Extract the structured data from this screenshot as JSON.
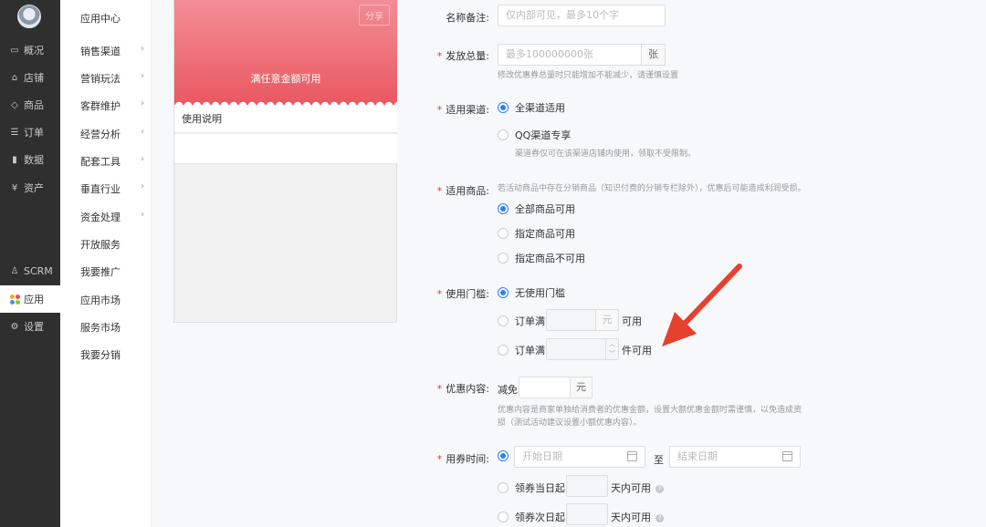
{
  "nav": {
    "items": [
      {
        "icon": "monitor-icon",
        "label": "概况"
      },
      {
        "icon": "store-icon",
        "label": "店铺"
      },
      {
        "icon": "tag-icon",
        "label": "商品"
      },
      {
        "icon": "order-icon",
        "label": "订单"
      },
      {
        "icon": "chart-icon",
        "label": "数据"
      },
      {
        "icon": "yen-icon",
        "label": "资产"
      },
      {
        "icon": "person-icon",
        "label": "SCRM"
      },
      {
        "icon": "apps-icon",
        "label": "应用"
      },
      {
        "icon": "gear-icon",
        "label": "设置"
      }
    ],
    "app_colors": [
      "#f5a623",
      "#e94e4e",
      "#4a90e2",
      "#7ed321"
    ]
  },
  "subnav": {
    "title": "应用中心",
    "items": [
      {
        "label": "销售渠道",
        "chevron": "›"
      },
      {
        "label": "营销玩法",
        "chevron": "›"
      },
      {
        "label": "客群维护",
        "chevron": "›"
      },
      {
        "label": "经营分析",
        "chevron": "›"
      },
      {
        "label": "配套工具",
        "chevron": "›"
      },
      {
        "label": "垂直行业",
        "chevron": "›"
      },
      {
        "label": "资金处理",
        "chevron": "›"
      },
      {
        "label": "开放服务",
        "chevron": ""
      },
      {
        "label": "我要推广",
        "chevron": ""
      },
      {
        "label": "应用市场",
        "chevron": ""
      },
      {
        "label": "服务市场",
        "chevron": ""
      },
      {
        "label": "我要分销",
        "chevron": ""
      }
    ]
  },
  "preview": {
    "share": "分享",
    "banner_text": "满任意金额可用",
    "usage_title": "使用说明"
  },
  "form": {
    "star": "*",
    "name_note": {
      "label": "名称备注:",
      "placeholder": "仅内部可见，最多10个字"
    },
    "total": {
      "label": "发放总量:",
      "placeholder": "最多100000000张",
      "unit": "张",
      "help": "修改优惠券总量时只能增加不能减少，请谨慎设置"
    },
    "channel": {
      "label": "适用渠道:",
      "opt_all": "全渠道适用",
      "opt_qq": "QQ渠道专享",
      "help": "渠道券仅可在该渠道店铺内使用，领取不受限制。"
    },
    "goods": {
      "label": "适用商品:",
      "help": "若活动商品中存在分销商品（知识付费的分销专栏除外），优惠后可能造成利润受损。",
      "opt_all": "全部商品可用",
      "opt_some": "指定商品可用",
      "opt_not": "指定商品不可用"
    },
    "threshold": {
      "label": "使用门槛:",
      "opt_none": "无使用门槛",
      "opt_amount_prefix": "订单满",
      "opt_amount_unit": "元",
      "opt_amount_suffix": "可用",
      "opt_count_prefix": "订单满",
      "opt_count_suffix": "件可用",
      "spin_up": "︿",
      "spin_down": "﹀"
    },
    "discount": {
      "label": "优惠内容:",
      "prefix": "减免",
      "unit": "元",
      "help_line1": "优惠内容是商家单独给消费者的优惠金额，设置大额优惠金额时需谨慎，以免造成资",
      "help_line2": "损（测试活动建议设置小额优惠内容）。"
    },
    "time": {
      "label": "用券时间:",
      "start_placeholder": "开始日期",
      "to": "至",
      "end_placeholder": "结束日期",
      "opt_same_day_prefix": "领券当日起",
      "opt_same_day_suffix": "天内可用",
      "opt_next_day_prefix": "领券次日起",
      "opt_next_day_suffix": "天内可用",
      "qmark": "?"
    }
  },
  "annotation": {
    "arrow_color": "#e8402f"
  }
}
